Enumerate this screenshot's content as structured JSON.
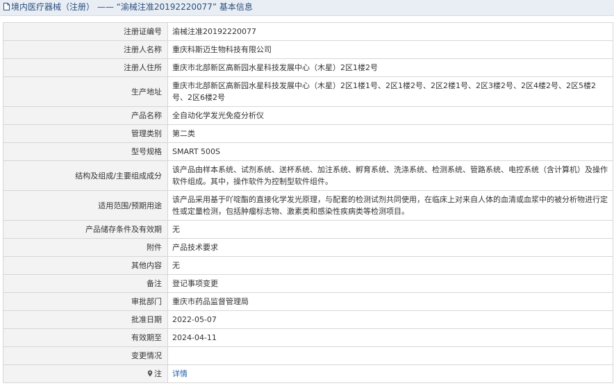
{
  "header": {
    "prefix": "境内医疗器械（注册）",
    "separator": "——",
    "reg_quote": "“渝械注准20192220077”",
    "suffix": "基本信息"
  },
  "rows": [
    {
      "label": "注册证编号",
      "value": "渝械注准20192220077"
    },
    {
      "label": "注册人名称",
      "value": "重庆科斯迈生物科技有限公司"
    },
    {
      "label": "注册人住所",
      "value": "重庆市北部新区高新园水星科技发展中心（木星）2区1楼2号"
    },
    {
      "label": "生产地址",
      "value": "重庆市北部新区高新园水星科技发展中心（木星）2区1楼1号、2区1楼2号、2区2楼1号、2区3楼2号、2区4楼2号、2区5楼2号、2区6楼2号"
    },
    {
      "label": "产品名称",
      "value": "全自动化学发光免疫分析仪"
    },
    {
      "label": "管理类别",
      "value": "第二类"
    },
    {
      "label": "型号规格",
      "value": "SMART 500S"
    },
    {
      "label": "结构及组成/主要组成成分",
      "value": "该产品由样本系统、试剂系统、送杯系统、加注系统、孵育系统、洗涤系统、检测系统、管路系统、电控系统（含计算机）及操作软件组成。其中，操作软件为控制型软件组件。"
    },
    {
      "label": "适用范围/预期用途",
      "value": "该产品采用基于吖啶酯的直接化学发光原理，与配套的检测试剂共同使用，在临床上对来自人体的血清或血浆中的被分析物进行定性或定量检测，包括肿瘤标志物、激素类和感染性疾病类等检测项目。"
    },
    {
      "label": "产品储存条件及有效期",
      "value": "无"
    },
    {
      "label": "附件",
      "value": "产品技术要求"
    },
    {
      "label": "其他内容",
      "value": "无"
    },
    {
      "label": "备注",
      "value": "登记事项变更"
    },
    {
      "label": "审批部门",
      "value": "重庆市药品监督管理局"
    },
    {
      "label": "批准日期",
      "value": "2022-05-07"
    },
    {
      "label": "有效期至",
      "value": "2024-04-11"
    },
    {
      "label": "变更情况",
      "value": ""
    }
  ],
  "note_row": {
    "label": "注",
    "link_text": "详情"
  },
  "colors": {
    "header_bg": "#e9eef5",
    "header_text": "#2b4f7c",
    "label_bg": "#f3f3f3",
    "border": "#d6d6d6",
    "link": "#1f5fa8"
  },
  "icons": {
    "header": "document-icon",
    "note": "location-pin-icon"
  }
}
